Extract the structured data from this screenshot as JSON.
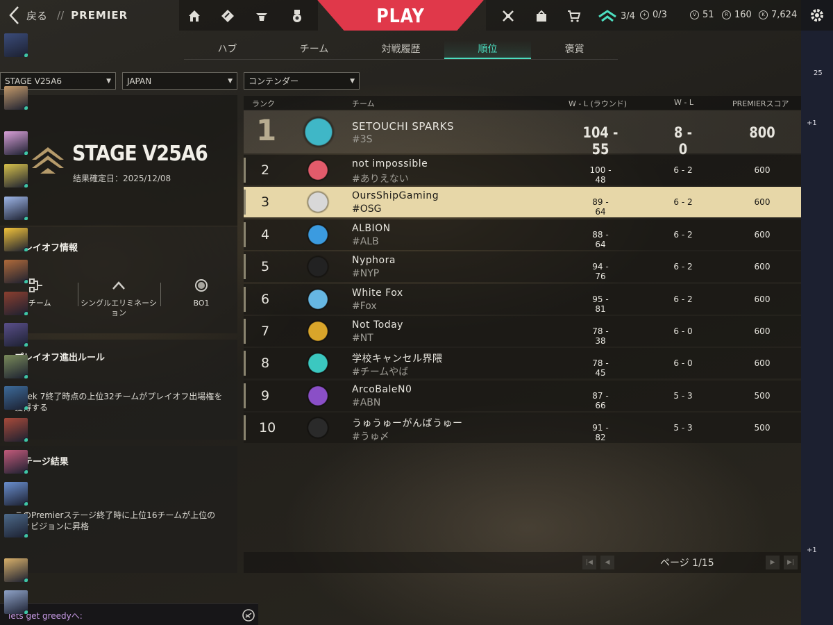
{
  "topbar": {
    "back_label": "戻る",
    "separator": "//",
    "section_title": "PREMIER",
    "play_label": "PLAY",
    "matches_count": "3/4",
    "extra_count": "0/3",
    "currency_vp": "51",
    "currency_rad": "160",
    "currency_kc": "7,624"
  },
  "tabs": [
    {
      "label": "ハブ"
    },
    {
      "label": "チーム"
    },
    {
      "label": "対戦履歴"
    },
    {
      "label": "順位"
    },
    {
      "label": "褒賞"
    }
  ],
  "filters": {
    "stage": "STAGE V25A6",
    "region": "JAPAN",
    "division": "コンテンダー"
  },
  "stage": {
    "title": "STAGE V25A6",
    "date_label": "結果確定日：2025/12/08"
  },
  "playoff": {
    "heading": "プレイオフ情報",
    "teams": "8 チーム",
    "format": "シングルエリミネーション",
    "bo": "BO1"
  },
  "rules": {
    "heading": "プレイオフ進出ルール",
    "text": "Week 7終了時点の上位32チームがプレイオフ出場権を獲得する"
  },
  "results": {
    "heading": "ステージ結果",
    "text": "このPremierステージ終了時に上位16チームが上位のディビジョンに昇格"
  },
  "table": {
    "headers": {
      "rank": "ランク",
      "team": "チーム",
      "wl_rounds": "W - L (ラウンド)",
      "wl": "W - L",
      "score": "PREMIERスコア"
    },
    "rows": [
      {
        "rank": "1",
        "name": "SETOUCHI SPARKS",
        "tag": "#3S",
        "wl_rounds": "104 - 55",
        "wl": "8 - 0",
        "score": "800",
        "color": "#3fb7c7"
      },
      {
        "rank": "2",
        "name": "not impossible",
        "tag": "#ありえない",
        "wl_rounds": "100 - 48",
        "wl": "6 - 2",
        "score": "600",
        "color": "#e25b6b"
      },
      {
        "rank": "3",
        "name": "OursShipGaming",
        "tag": "#OSG",
        "wl_rounds": "89 - 64",
        "wl": "6 - 2",
        "score": "600",
        "color": "#d8d8d8"
      },
      {
        "rank": "4",
        "name": "ALBION",
        "tag": "#ALB",
        "wl_rounds": "88 - 64",
        "wl": "6 - 2",
        "score": "600",
        "color": "#3b9be0"
      },
      {
        "rank": "5",
        "name": "Nyphora",
        "tag": "#NYP",
        "wl_rounds": "94 - 76",
        "wl": "6 - 2",
        "score": "600",
        "color": "#222222"
      },
      {
        "rank": "6",
        "name": "White Fox",
        "tag": "#Fox",
        "wl_rounds": "95 - 81",
        "wl": "6 - 2",
        "score": "600",
        "color": "#66b7e3"
      },
      {
        "rank": "7",
        "name": "Not Today",
        "tag": "#NT",
        "wl_rounds": "78 - 38",
        "wl": "6 - 0",
        "score": "600",
        "color": "#d9a52a"
      },
      {
        "rank": "8",
        "name": "学校キャンセル界隈",
        "tag": "#チームやば",
        "wl_rounds": "78 - 45",
        "wl": "6 - 0",
        "score": "600",
        "color": "#3bc8c0"
      },
      {
        "rank": "9",
        "name": "ArcoBaleN0",
        "tag": "#ABN",
        "wl_rounds": "87 - 66",
        "wl": "5 - 3",
        "score": "500",
        "color": "#8a4fc7"
      },
      {
        "rank": "10",
        "name": "うゅうゅーがんばうゅー",
        "tag": "#うゅ〆",
        "wl_rounds": "91 - 82",
        "wl": "5 - 3",
        "score": "500",
        "color": "#2a2a2a"
      }
    ],
    "pager": "ページ 1/15"
  },
  "chat": {
    "label": "lets get greedyへ:"
  },
  "party": {
    "count": "25",
    "plus1": "+1",
    "plus2": "+1"
  },
  "colors": {
    "play": "#e0384a",
    "accent": "#4cdec0",
    "highlight": "#e7d7a8"
  }
}
